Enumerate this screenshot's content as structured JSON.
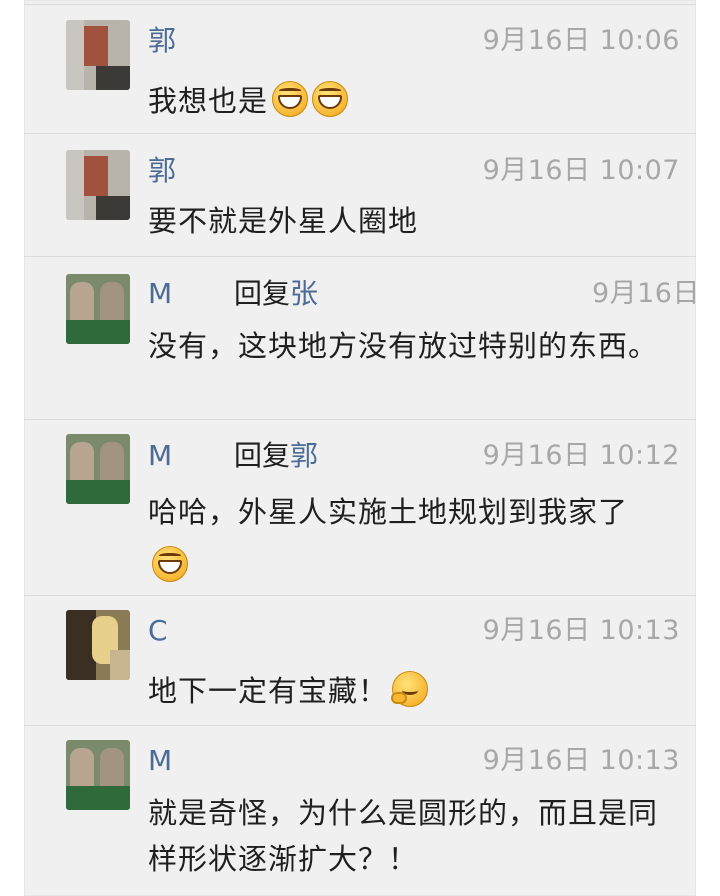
{
  "comments": [
    {
      "name": "郭",
      "time": "9月16日 10:06",
      "text": "我想也是",
      "emojis": [
        "grin",
        "grin"
      ]
    },
    {
      "name": "郭",
      "time": "9月16日 10:07",
      "text": "要不就是外星人圈地",
      "emojis": []
    },
    {
      "name": "M",
      "reply_label": "回复",
      "reply_target": "张",
      "time": "9月16日",
      "text": "没有，这块地方没有放过特别的东西。",
      "emojis": []
    },
    {
      "name": "M",
      "reply_label": "回复",
      "reply_target": "郭",
      "time": "9月16日 10:12",
      "text": "哈哈，外星人实施土地规划到我家了",
      "emojis": [
        "grin"
      ]
    },
    {
      "name": "C",
      "time": "9月16日 10:13",
      "text": "地下一定有宝藏！",
      "emojis": [
        "think"
      ]
    },
    {
      "name": "M",
      "time": "9月16日 10:13",
      "text": "就是奇怪，为什么是圆形的，而且是同样形状逐渐扩大？！",
      "emojis": []
    }
  ],
  "colors": {
    "name": "#4c6b97",
    "time": "#a7a7a7",
    "text": "#1f1f1f",
    "background": "#f0f0f0"
  }
}
